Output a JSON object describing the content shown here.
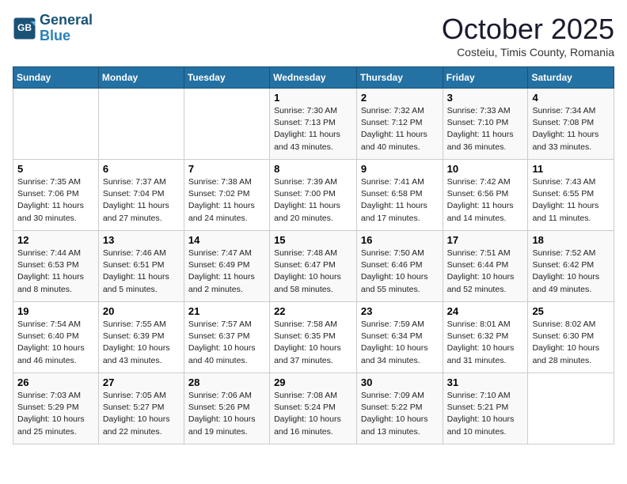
{
  "header": {
    "logo_line1": "General",
    "logo_line2": "Blue",
    "month_title": "October 2025",
    "subtitle": "Costeiu, Timis County, Romania"
  },
  "weekdays": [
    "Sunday",
    "Monday",
    "Tuesday",
    "Wednesday",
    "Thursday",
    "Friday",
    "Saturday"
  ],
  "weeks": [
    [
      {
        "day": "",
        "info": ""
      },
      {
        "day": "",
        "info": ""
      },
      {
        "day": "",
        "info": ""
      },
      {
        "day": "1",
        "info": "Sunrise: 7:30 AM\nSunset: 7:13 PM\nDaylight: 11 hours\nand 43 minutes."
      },
      {
        "day": "2",
        "info": "Sunrise: 7:32 AM\nSunset: 7:12 PM\nDaylight: 11 hours\nand 40 minutes."
      },
      {
        "day": "3",
        "info": "Sunrise: 7:33 AM\nSunset: 7:10 PM\nDaylight: 11 hours\nand 36 minutes."
      },
      {
        "day": "4",
        "info": "Sunrise: 7:34 AM\nSunset: 7:08 PM\nDaylight: 11 hours\nand 33 minutes."
      }
    ],
    [
      {
        "day": "5",
        "info": "Sunrise: 7:35 AM\nSunset: 7:06 PM\nDaylight: 11 hours\nand 30 minutes."
      },
      {
        "day": "6",
        "info": "Sunrise: 7:37 AM\nSunset: 7:04 PM\nDaylight: 11 hours\nand 27 minutes."
      },
      {
        "day": "7",
        "info": "Sunrise: 7:38 AM\nSunset: 7:02 PM\nDaylight: 11 hours\nand 24 minutes."
      },
      {
        "day": "8",
        "info": "Sunrise: 7:39 AM\nSunset: 7:00 PM\nDaylight: 11 hours\nand 20 minutes."
      },
      {
        "day": "9",
        "info": "Sunrise: 7:41 AM\nSunset: 6:58 PM\nDaylight: 11 hours\nand 17 minutes."
      },
      {
        "day": "10",
        "info": "Sunrise: 7:42 AM\nSunset: 6:56 PM\nDaylight: 11 hours\nand 14 minutes."
      },
      {
        "day": "11",
        "info": "Sunrise: 7:43 AM\nSunset: 6:55 PM\nDaylight: 11 hours\nand 11 minutes."
      }
    ],
    [
      {
        "day": "12",
        "info": "Sunrise: 7:44 AM\nSunset: 6:53 PM\nDaylight: 11 hours\nand 8 minutes."
      },
      {
        "day": "13",
        "info": "Sunrise: 7:46 AM\nSunset: 6:51 PM\nDaylight: 11 hours\nand 5 minutes."
      },
      {
        "day": "14",
        "info": "Sunrise: 7:47 AM\nSunset: 6:49 PM\nDaylight: 11 hours\nand 2 minutes."
      },
      {
        "day": "15",
        "info": "Sunrise: 7:48 AM\nSunset: 6:47 PM\nDaylight: 10 hours\nand 58 minutes."
      },
      {
        "day": "16",
        "info": "Sunrise: 7:50 AM\nSunset: 6:46 PM\nDaylight: 10 hours\nand 55 minutes."
      },
      {
        "day": "17",
        "info": "Sunrise: 7:51 AM\nSunset: 6:44 PM\nDaylight: 10 hours\nand 52 minutes."
      },
      {
        "day": "18",
        "info": "Sunrise: 7:52 AM\nSunset: 6:42 PM\nDaylight: 10 hours\nand 49 minutes."
      }
    ],
    [
      {
        "day": "19",
        "info": "Sunrise: 7:54 AM\nSunset: 6:40 PM\nDaylight: 10 hours\nand 46 minutes."
      },
      {
        "day": "20",
        "info": "Sunrise: 7:55 AM\nSunset: 6:39 PM\nDaylight: 10 hours\nand 43 minutes."
      },
      {
        "day": "21",
        "info": "Sunrise: 7:57 AM\nSunset: 6:37 PM\nDaylight: 10 hours\nand 40 minutes."
      },
      {
        "day": "22",
        "info": "Sunrise: 7:58 AM\nSunset: 6:35 PM\nDaylight: 10 hours\nand 37 minutes."
      },
      {
        "day": "23",
        "info": "Sunrise: 7:59 AM\nSunset: 6:34 PM\nDaylight: 10 hours\nand 34 minutes."
      },
      {
        "day": "24",
        "info": "Sunrise: 8:01 AM\nSunset: 6:32 PM\nDaylight: 10 hours\nand 31 minutes."
      },
      {
        "day": "25",
        "info": "Sunrise: 8:02 AM\nSunset: 6:30 PM\nDaylight: 10 hours\nand 28 minutes."
      }
    ],
    [
      {
        "day": "26",
        "info": "Sunrise: 7:03 AM\nSunset: 5:29 PM\nDaylight: 10 hours\nand 25 minutes."
      },
      {
        "day": "27",
        "info": "Sunrise: 7:05 AM\nSunset: 5:27 PM\nDaylight: 10 hours\nand 22 minutes."
      },
      {
        "day": "28",
        "info": "Sunrise: 7:06 AM\nSunset: 5:26 PM\nDaylight: 10 hours\nand 19 minutes."
      },
      {
        "day": "29",
        "info": "Sunrise: 7:08 AM\nSunset: 5:24 PM\nDaylight: 10 hours\nand 16 minutes."
      },
      {
        "day": "30",
        "info": "Sunrise: 7:09 AM\nSunset: 5:22 PM\nDaylight: 10 hours\nand 13 minutes."
      },
      {
        "day": "31",
        "info": "Sunrise: 7:10 AM\nSunset: 5:21 PM\nDaylight: 10 hours\nand 10 minutes."
      },
      {
        "day": "",
        "info": ""
      }
    ]
  ]
}
